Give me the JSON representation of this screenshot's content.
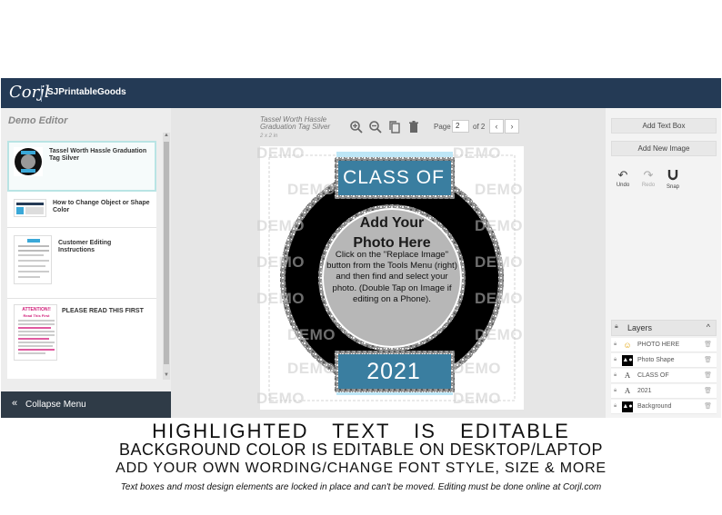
{
  "app": {
    "logo": "Corjl",
    "shop_name": "SJPrintableGoods"
  },
  "left_panel": {
    "title": "Demo Editor",
    "items": [
      {
        "label": "Tassel Worth Hassle Graduation Tag Silver",
        "active": true
      },
      {
        "label": "How to Change Object or Shape Color",
        "active": false
      },
      {
        "label": "Customer Editing Instructions",
        "active": false
      },
      {
        "label": "PLEASE READ THIS FIRST",
        "active": false,
        "thumb_heading": "ATTENTION!!",
        "thumb_sub": "Read This First"
      }
    ],
    "collapse_label": "Collapse Menu"
  },
  "canvas": {
    "doc_title": "Tassel Worth Hassle Graduation Tag Silver",
    "doc_size": "2 x 2 in",
    "page_label": "Page",
    "page_value": "2",
    "page_of": "of 2",
    "watermark": "DEMO",
    "design": {
      "class_of": "CLASS OF",
      "year": "2021",
      "photo_title": "Add Your Photo Here",
      "photo_instructions": "Click on the \"Replace Image\" button from the Tools Menu (right) and then find and select your photo. (Double Tap on Image if editing on a Phone).",
      "colors": {
        "ring": "#000000",
        "banner": "#3aa8d8",
        "photo_bg": "#b7b7b7",
        "glitter": "#9a9a9a"
      }
    }
  },
  "right_panel": {
    "add_text_box": "Add Text Box",
    "add_new_image": "Add New Image",
    "tools": [
      {
        "label": "Undo",
        "icon": "undo-icon",
        "enabled": true
      },
      {
        "label": "Redo",
        "icon": "redo-icon",
        "enabled": false
      },
      {
        "label": "Snap",
        "icon": "magnet-icon",
        "enabled": true
      }
    ],
    "layers_title": "Layers",
    "layers": [
      {
        "name": "PHOTO HERE",
        "icon": "smiley-icon"
      },
      {
        "name": "Photo Shape",
        "icon": "shapes-icon"
      },
      {
        "name": "CLASS OF",
        "icon": "text-icon"
      },
      {
        "name": "2021",
        "icon": "text-icon"
      },
      {
        "name": "Background",
        "icon": "shapes-icon"
      }
    ]
  },
  "captions": {
    "line1": "HIGHLIGHTED TEXT IS EDITABLE",
    "line2": "BACKGROUND COLOR IS  EDITABLE ON DESKTOP/LAPTOP",
    "line3": "ADD YOUR OWN WORDING/CHANGE FONT STYLE, SIZE & MORE",
    "line4": "Text boxes and most design elements are locked in place and can't be moved. Editing must be done online at Corjl.com"
  }
}
